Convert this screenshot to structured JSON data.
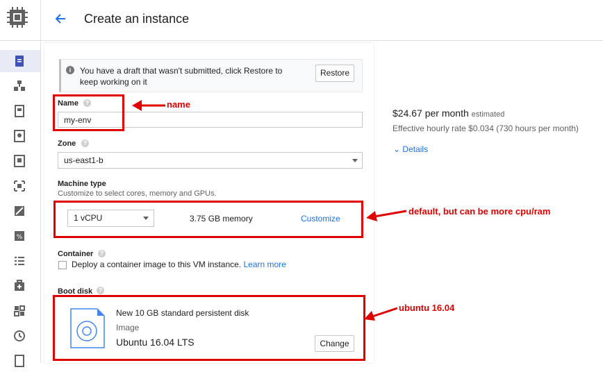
{
  "header": {
    "title": "Create an instance"
  },
  "draft_banner": {
    "text": "You have a draft that wasn't submitted, click Restore to keep working on it",
    "restore_label": "Restore"
  },
  "form": {
    "name": {
      "label": "Name",
      "value": "my-env"
    },
    "zone": {
      "label": "Zone",
      "value": "us-east1-b"
    },
    "machine_type": {
      "label": "Machine type",
      "hint": "Customize to select cores, memory and GPUs.",
      "cpu_value": "1 vCPU",
      "memory": "3.75 GB memory",
      "customize_label": "Customize"
    },
    "container": {
      "label": "Container",
      "checkbox_text": "Deploy a container image to this VM instance.",
      "learn_more": "Learn more"
    },
    "boot_disk": {
      "label": "Boot disk",
      "title": "New 10 GB standard persistent disk",
      "type": "Image",
      "image": "Ubuntu 16.04 LTS",
      "change_label": "Change"
    }
  },
  "pricing": {
    "price": "$24.67 per month",
    "estimated": "estimated",
    "hourly": "Effective hourly rate $0.034 (730 hours per month)",
    "details_label": "Details"
  },
  "annotations": {
    "name": "name",
    "machine": "default, but can be more cpu/ram",
    "boot": "ubuntu 16.04"
  },
  "colors": {
    "accent": "#1a73e8",
    "annotation": "#e00000"
  }
}
